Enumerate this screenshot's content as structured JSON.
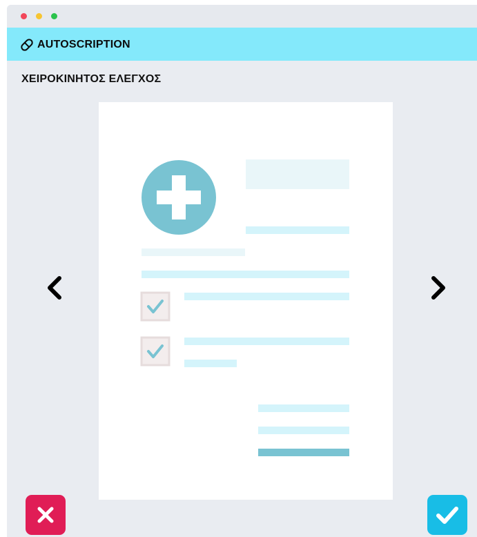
{
  "app": {
    "brand_name": "AUTOSCRIPTION",
    "logo_icon": "pill-icon"
  },
  "page": {
    "title": "ΧΕΙΡΟΚΙΝΗΤΟΣ ΕΛΕΓΧΟΣ"
  },
  "document_preview": {
    "icon": "medical-cross-icon",
    "checked_items": 2
  },
  "navigation": {
    "prev_icon": "chevron-left-icon",
    "next_icon": "chevron-right-icon"
  },
  "actions": {
    "reject_icon": "close-icon",
    "approve_icon": "check-icon"
  },
  "colors": {
    "appbar": "#84e9fb",
    "reject": "#e01d56",
    "approve": "#18bde6",
    "doc_accent": "#79c3d2",
    "placeholder_line": "#d4f4fb"
  }
}
